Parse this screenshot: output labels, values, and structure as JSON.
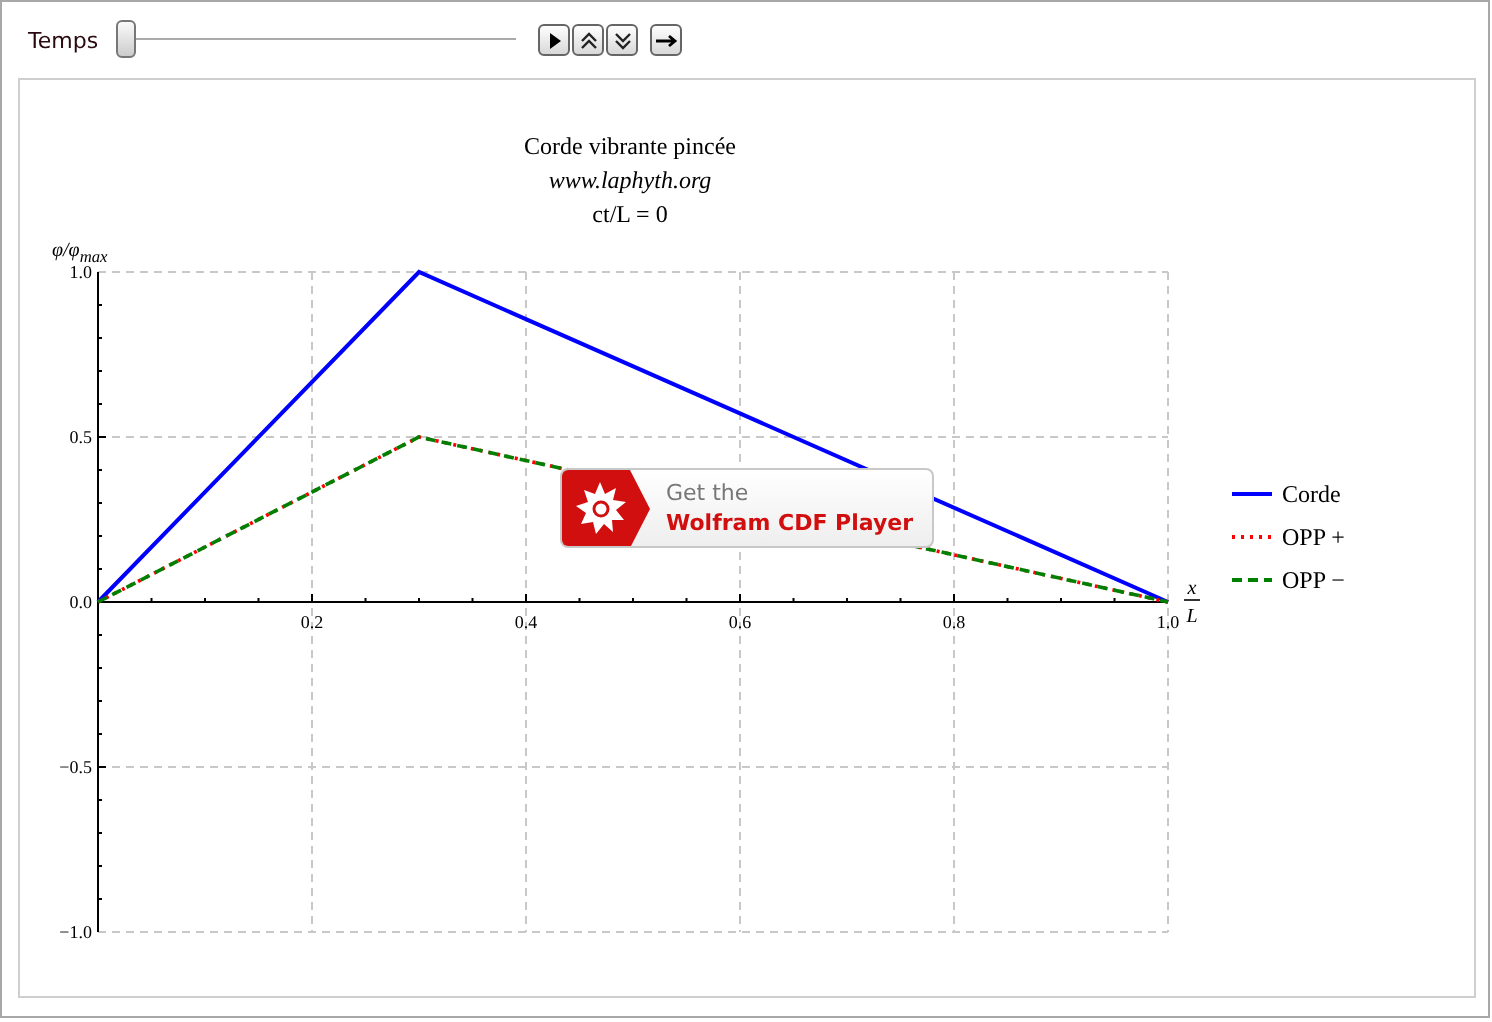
{
  "controls": {
    "label": "Temps",
    "slider": {
      "level": 0
    },
    "buttons": [
      {
        "kind": "play"
      },
      {
        "kind": "faster"
      },
      {
        "kind": "slower"
      },
      {
        "kind": "step"
      }
    ]
  },
  "player_badge": {
    "line_1": "Get the",
    "line_2": "Wolfram CDF Player"
  },
  "plot": {
    "title_lines": [
      {
        "text": "Corde vibrante pincée",
        "italic": false
      },
      {
        "text": "www.laphyth.org",
        "italic": true
      },
      {
        "text": "ct/L = 0",
        "italic": false
      }
    ],
    "x_label": {
      "numerator": "x",
      "denominator": "L"
    },
    "chart_data": {
      "type": "line",
      "ylabel": "φ/φ$_{max}$",
      "x": [
        0,
        0.3,
        1
      ],
      "series": [
        {
          "name": "Corde",
          "color": "#0000ff",
          "line_style": "solid",
          "values": [
            0,
            1,
            0
          ]
        },
        {
          "name": "OPP +",
          "color": "#ff0000",
          "line_style": "dotted",
          "values": [
            0,
            0.5,
            0
          ]
        },
        {
          "name": "OPP −",
          "color": "#008000",
          "line_style": "dashed",
          "values": [
            0,
            0.5,
            0
          ]
        }
      ],
      "grid": true,
      "legend": true,
      "xlim": [
        0,
        1
      ],
      "ylim": [
        -1,
        1
      ],
      "xticks": [
        0.2,
        0.4,
        0.6,
        0.8,
        {
          "value": 1,
          "label": "1.0"
        }
      ],
      "yticks": [
        {
          "value": -1,
          "label": "−1.0"
        },
        {
          "value": -0.5,
          "label": "−0.5"
        },
        {
          "value": 0,
          "label": "0.0"
        },
        {
          "value": 0.5,
          "label": "0.5"
        },
        {
          "value": 1,
          "label": "1.0"
        }
      ]
    }
  }
}
